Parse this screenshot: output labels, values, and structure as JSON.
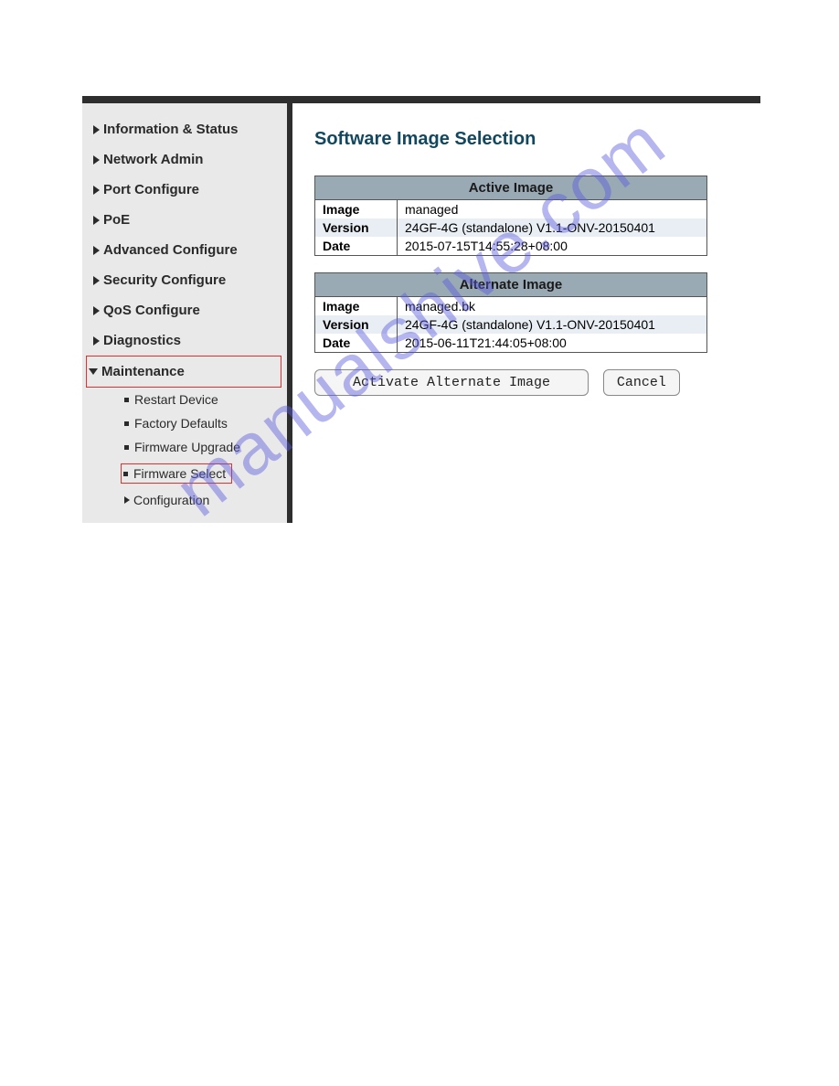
{
  "sidebar": {
    "items": [
      {
        "label": "Information & Status",
        "expanded": false
      },
      {
        "label": "Network Admin",
        "expanded": false
      },
      {
        "label": "Port Configure",
        "expanded": false
      },
      {
        "label": "PoE",
        "expanded": false
      },
      {
        "label": "Advanced Configure",
        "expanded": false
      },
      {
        "label": "Security Configure",
        "expanded": false
      },
      {
        "label": "QoS Configure",
        "expanded": false
      },
      {
        "label": "Diagnostics",
        "expanded": false
      },
      {
        "label": "Maintenance",
        "expanded": true
      }
    ],
    "maintenance_children": {
      "restart": "Restart Device",
      "factory": "Factory Defaults",
      "fw_upgrade": "Firmware Upgrade",
      "fw_select": "Firmware Select",
      "configuration": "Configuration"
    }
  },
  "main": {
    "title": "Software Image Selection",
    "tables": {
      "active": {
        "header": "Active Image",
        "rows": {
          "image_label": "Image",
          "image_value": "managed",
          "version_label": "Version",
          "version_value": "24GF-4G (standalone) V1.1-ONV-20150401",
          "date_label": "Date",
          "date_value": "2015-07-15T14:55:28+08:00"
        }
      },
      "alternate": {
        "header": "Alternate Image",
        "rows": {
          "image_label": "Image",
          "image_value": "managed.bk",
          "version_label": "Version",
          "version_value": "24GF-4G (standalone) V1.1-ONV-20150401",
          "date_label": "Date",
          "date_value": "2015-06-11T21:44:05+08:00"
        }
      }
    },
    "buttons": {
      "activate": "Activate Alternate Image",
      "cancel": "Cancel"
    }
  },
  "watermark": "manualshive.com"
}
